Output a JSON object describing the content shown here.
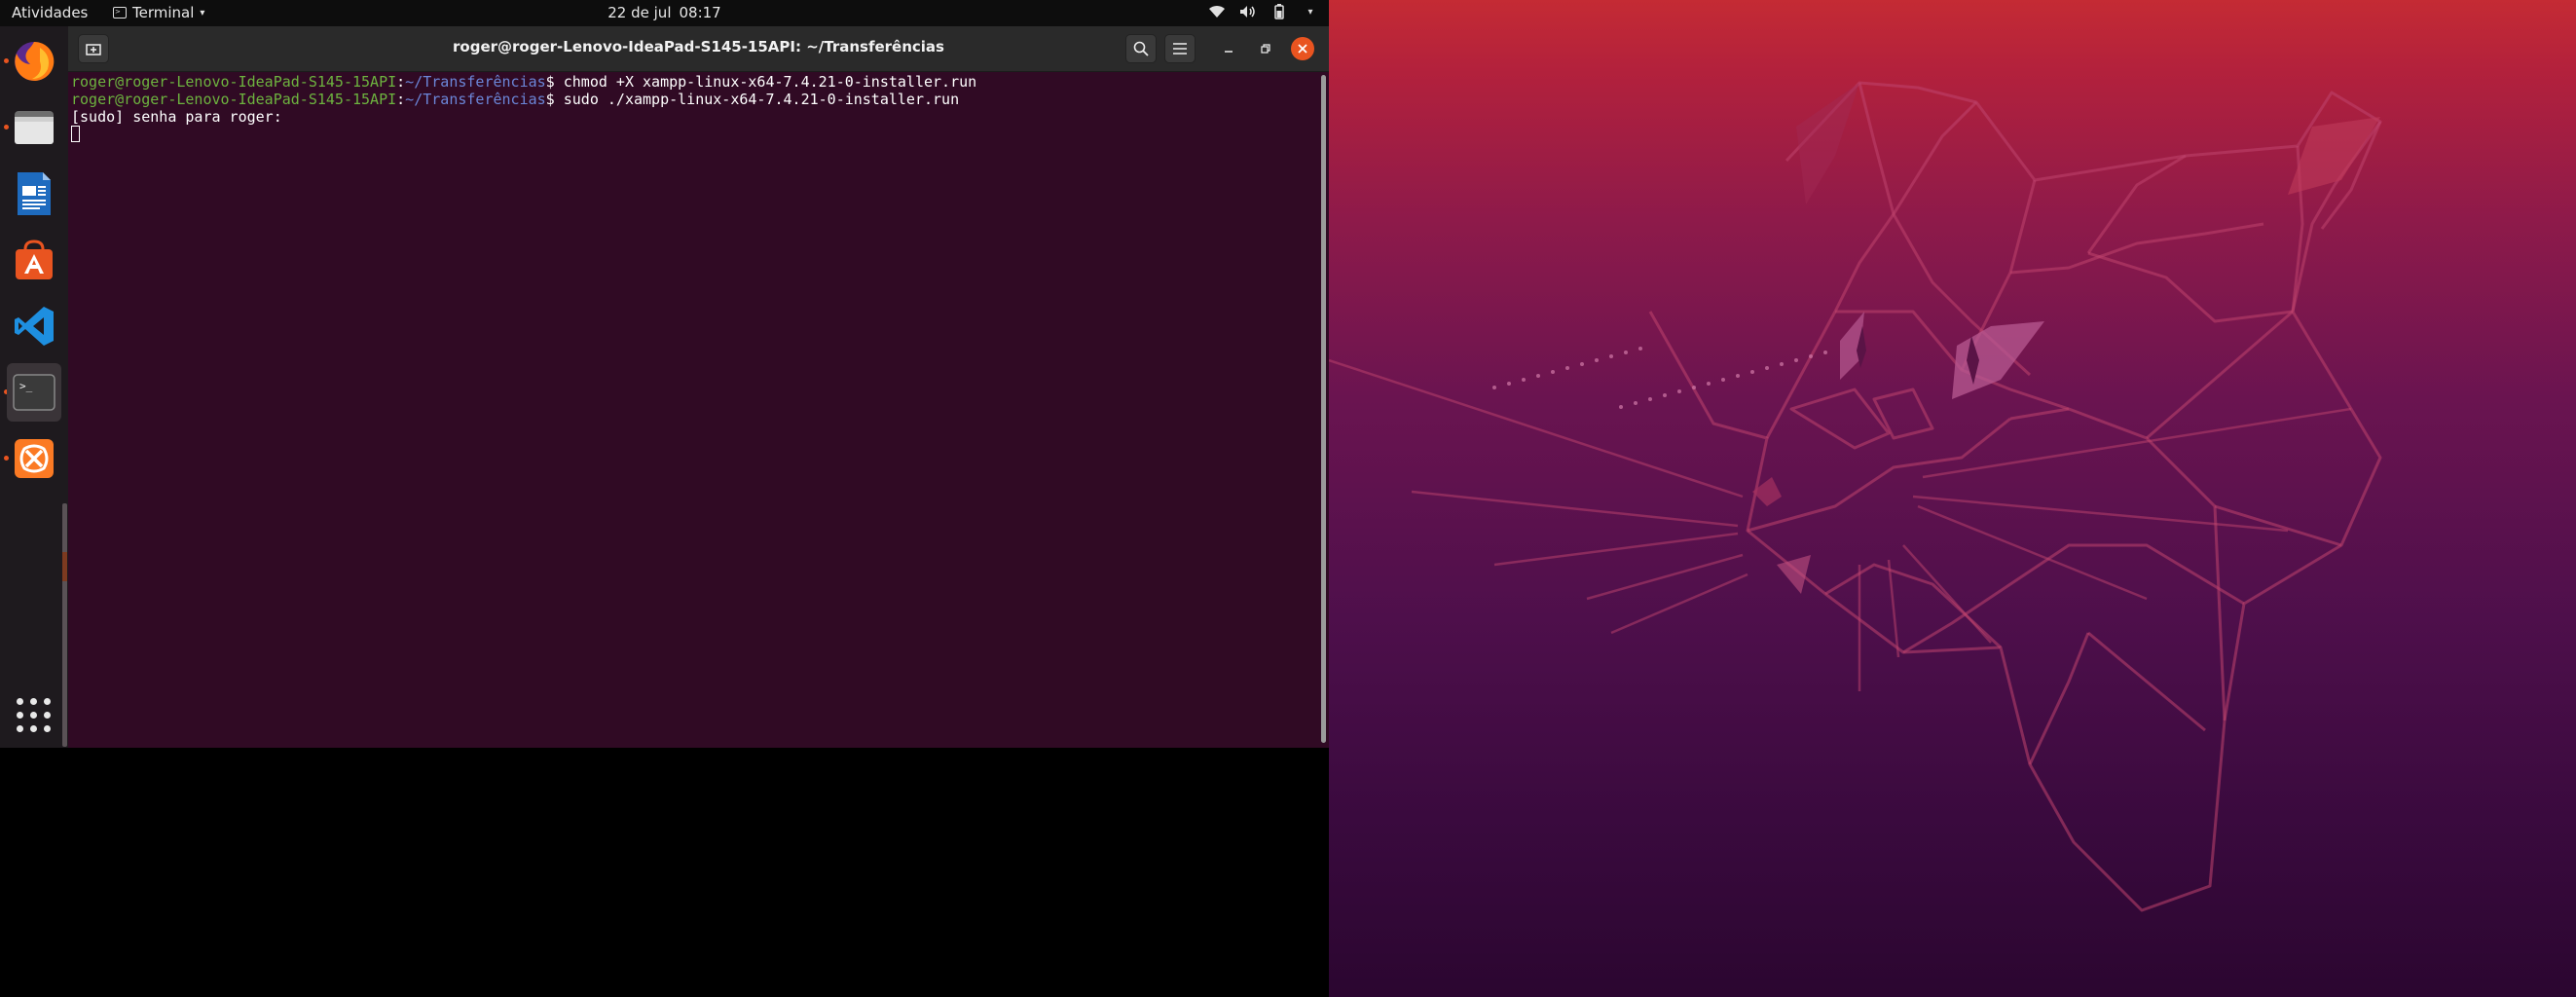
{
  "top_bar": {
    "activities": "Atividades",
    "app_menu": "Terminal",
    "date": "22 de jul",
    "time": "08:17"
  },
  "dock": {
    "items": [
      {
        "name": "firefox-icon",
        "running": true
      },
      {
        "name": "files-icon",
        "running": true
      },
      {
        "name": "writer-icon",
        "running": false
      },
      {
        "name": "software-icon",
        "running": false
      },
      {
        "name": "vscode-icon",
        "running": false
      },
      {
        "name": "terminal-icon",
        "running": true,
        "active": true
      },
      {
        "name": "xampp-icon",
        "running": true
      }
    ]
  },
  "terminal": {
    "title": "roger@roger-Lenovo-IdeaPad-S145-15API: ~/Transferências",
    "lines": [
      {
        "user": "roger@roger-Lenovo-IdeaPad-S145-15API",
        "path": "~/Transferências",
        "command": "chmod +X xampp-linux-x64-7.4.21-0-installer.run"
      },
      {
        "user": "roger@roger-Lenovo-IdeaPad-S145-15API",
        "path": "~/Transferências",
        "command": "sudo ./xampp-linux-x64-7.4.21-0-installer.run"
      }
    ],
    "sudo_prompt": "[sudo] senha para roger:"
  },
  "colors": {
    "ubuntu_orange": "#e95420",
    "terminal_bg": "#300a24",
    "prompt_user": "#6db33f",
    "prompt_path": "#6b86d8"
  }
}
